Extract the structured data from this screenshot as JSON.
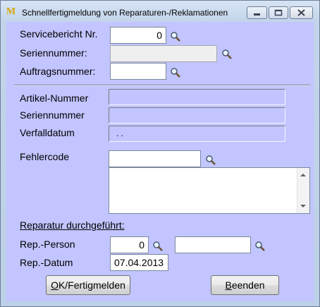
{
  "window": {
    "title": "Schnellfertigmeldung von Reparaturen-/Reklamationen",
    "app_icon_glyph": "M",
    "buttons": {
      "minimize": "▭",
      "maximize": "□",
      "close": "✕"
    }
  },
  "header_fields": {
    "servicebericht": {
      "label": "Servicebericht Nr.",
      "value": "0"
    },
    "seriennummer": {
      "label": "Seriennummer:",
      "value": ""
    },
    "auftragsnummer": {
      "label": "Auftragsnummer:",
      "value": ""
    }
  },
  "info": {
    "artikel_nummer": {
      "label": "Artikel-Nummer",
      "value": ""
    },
    "seriennummer": {
      "label": "Seriennummer",
      "value": ""
    },
    "verfalldatum": {
      "label": "Verfalldatum",
      "value": ". ."
    }
  },
  "fehlercode": {
    "label": "Fehlercode",
    "value": "",
    "text": ""
  },
  "reparatur": {
    "section_label": "Reparatur durchgeführt:",
    "person": {
      "label": "Rep.-Person",
      "value": "0",
      "name": ""
    },
    "datum": {
      "label": "Rep.-Datum",
      "value": "07.04.2013"
    }
  },
  "buttons": {
    "ok": "OK/Fertigmelden",
    "ok_accel": "O",
    "ok_rest": "K/Fertigmelden",
    "beenden": "Beenden",
    "beenden_accel": "B",
    "beenden_rest": "eenden"
  },
  "icons": {
    "lookup": "magnifier-icon"
  },
  "colors": {
    "client_bg": "#c2c5ff",
    "title_bg": "#c3d4ea"
  }
}
